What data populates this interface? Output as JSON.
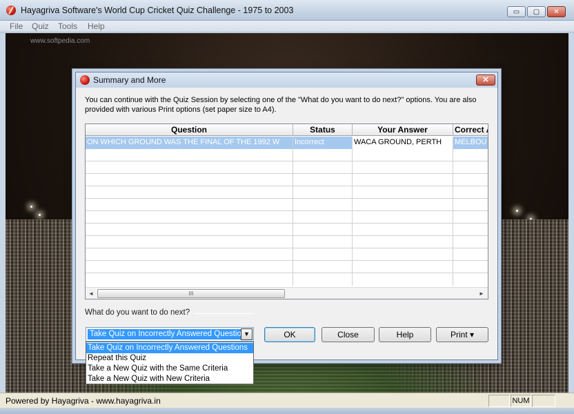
{
  "window": {
    "title": "Hayagriva Software's World Cup Cricket Quiz Challenge - 1975 to 2003",
    "controls": {
      "minimize": "▭",
      "maximize": "▢",
      "close": "✕"
    }
  },
  "menu": {
    "items": [
      "File",
      "Quiz",
      "Tools",
      "Help"
    ]
  },
  "watermark": "www.softpedia.com",
  "dialog": {
    "title": "Summary and More",
    "close": "✕",
    "intro": "You can continue with the Quiz Session by selecting one of the  \"What do you want to do next?\" options. You are also provided with various Print options (set paper size to A4).",
    "grid": {
      "columns": [
        "Question",
        "Status",
        "Your Answer",
        "Correct A"
      ],
      "rows": [
        {
          "question": "ON WHICH GROUND WAS THE FINAL OF THE 1992 W",
          "status": "Incorrect",
          "your_answer": "WACA GROUND, PERTH",
          "correct_answer": "MELBOU"
        }
      ],
      "scroll_left": "◄",
      "scroll_right": "►",
      "scroll_thumb": "III"
    },
    "next_label": "What do you want to do next?",
    "next_options": [
      "Take Quiz on Incorrectly Answered Questions",
      "Repeat this Quiz",
      "Take a New Quiz with the Same Criteria",
      "Take a New Quiz with New Criteria"
    ],
    "next_selected": "Take Quiz on Incorrectly Answered Questions",
    "combo_arrow": "▼",
    "buttons": {
      "ok": "OK",
      "close": "Close",
      "help": "Help",
      "print": "Print ▾"
    }
  },
  "status": {
    "text": "Powered by Hayagriva - www.hayagriva.in",
    "num": "NUM"
  }
}
